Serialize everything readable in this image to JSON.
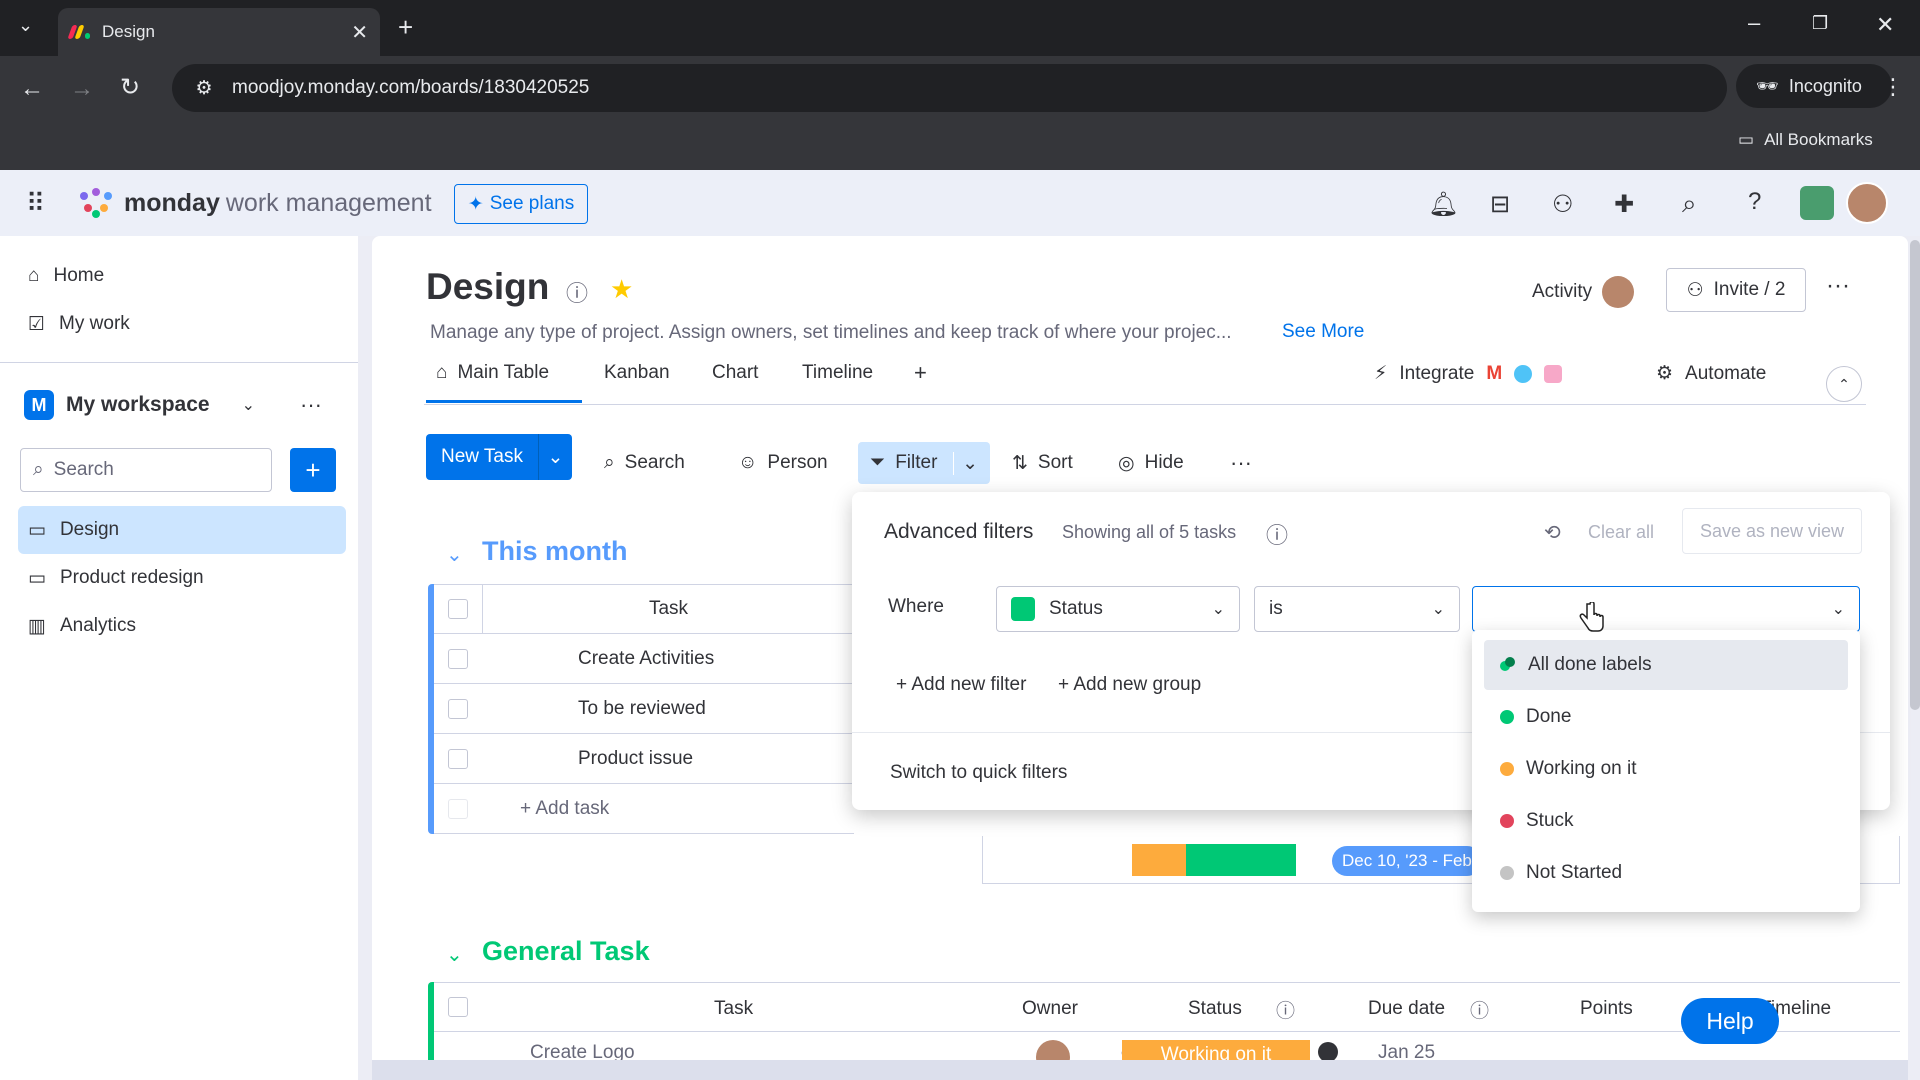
{
  "browser": {
    "tab_title": "Design",
    "new_tab": "+",
    "url": "moodjoy.monday.com/boards/1830420525",
    "incognito_label": "Incognito",
    "bookmarks_label": "All Bookmarks"
  },
  "app": {
    "logo_bold": "monday",
    "logo_rest": "work management",
    "see_plans": "See plans"
  },
  "sidebar": {
    "home": "Home",
    "my_work": "My work",
    "workspace": "My workspace",
    "workspace_initial": "M",
    "search_placeholder": "Search",
    "add": "+",
    "boards": [
      {
        "label": "Design"
      },
      {
        "label": "Product redesign"
      },
      {
        "label": "Analytics"
      }
    ]
  },
  "board": {
    "title": "Design",
    "description": "Manage any type of project. Assign owners, set timelines and keep track of where your projec...",
    "see_more": "See More",
    "activity": "Activity",
    "invite": "Invite / 2",
    "tabs": [
      "Main Table",
      "Kanban",
      "Chart",
      "Timeline",
      "+"
    ],
    "integrate": "Integrate",
    "automate": "Automate"
  },
  "toolbar": {
    "new_task": "New Task",
    "search": "Search",
    "person": "Person",
    "filter": "Filter",
    "sort": "Sort",
    "hide": "Hide",
    "more": "···"
  },
  "group1": {
    "title": "This month",
    "task_header": "Task",
    "rows": [
      "Create Activities",
      "To be reviewed",
      "Product issue"
    ],
    "add_task": "+ Add task",
    "summary_date": "Dec 10, '23 - Feb"
  },
  "group2": {
    "title": "General Task",
    "headers": [
      "Task",
      "Owner",
      "Status",
      "Due date",
      "Points",
      "Timeline"
    ],
    "first_row": "Create Logo",
    "first_status": "Working on it",
    "first_due": "Jan 25"
  },
  "filter_panel": {
    "title": "Advanced filters",
    "subtitle": "Showing all of 5 tasks",
    "clear_all": "Clear all",
    "save_view": "Save as new view",
    "where": "Where",
    "column": "Status",
    "operator": "is",
    "add_filter": "+ Add new filter",
    "add_group": "+ Add new group",
    "switch": "Switch to quick filters"
  },
  "dropdown": {
    "options": [
      {
        "label": "All done labels",
        "color": "#00c875"
      },
      {
        "label": "Done",
        "color": "#00c875"
      },
      {
        "label": "Working on it",
        "color": "#fdab3d"
      },
      {
        "label": "Stuck",
        "color": "#e2445c"
      },
      {
        "label": "Not Started",
        "color": "#c4c4c4"
      }
    ]
  },
  "help": "Help",
  "colors": {
    "accent": "#0073ea",
    "done": "#00c875",
    "working": "#fdab3d",
    "stuck": "#e2445c",
    "group2": "#00c875",
    "group1": "#579bfc"
  }
}
